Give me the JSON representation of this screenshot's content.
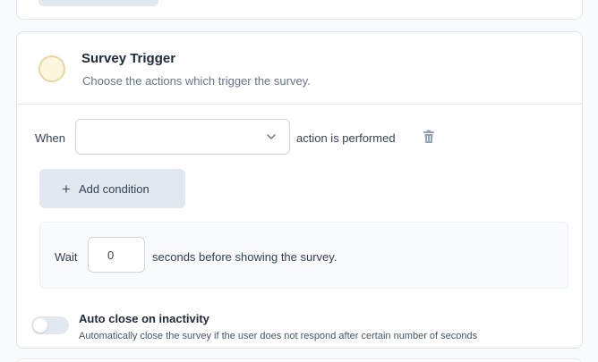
{
  "trigger": {
    "title": "Survey Trigger",
    "subtitle": "Choose the actions which trigger the survey.",
    "when_label": "When",
    "action_select_value": "",
    "action_suffix": "action is performed",
    "add_condition_label": "Add condition"
  },
  "wait": {
    "label": "Wait",
    "value": "0",
    "suffix": "seconds before showing the survey."
  },
  "auto_close": {
    "title": "Auto close on inactivity",
    "description": "Automatically close the survey if the user does not respond after certain number of seconds",
    "enabled": false
  },
  "colors": {
    "card_background": "#ffffff",
    "page_background": "#f8fafc",
    "button_background": "#e2e8f0",
    "icon_circle_fill": "#fdf6df",
    "icon_circle_border": "#ead79c"
  },
  "icons": [
    "chevron-down-icon",
    "trash-icon",
    "plus-icon"
  ]
}
